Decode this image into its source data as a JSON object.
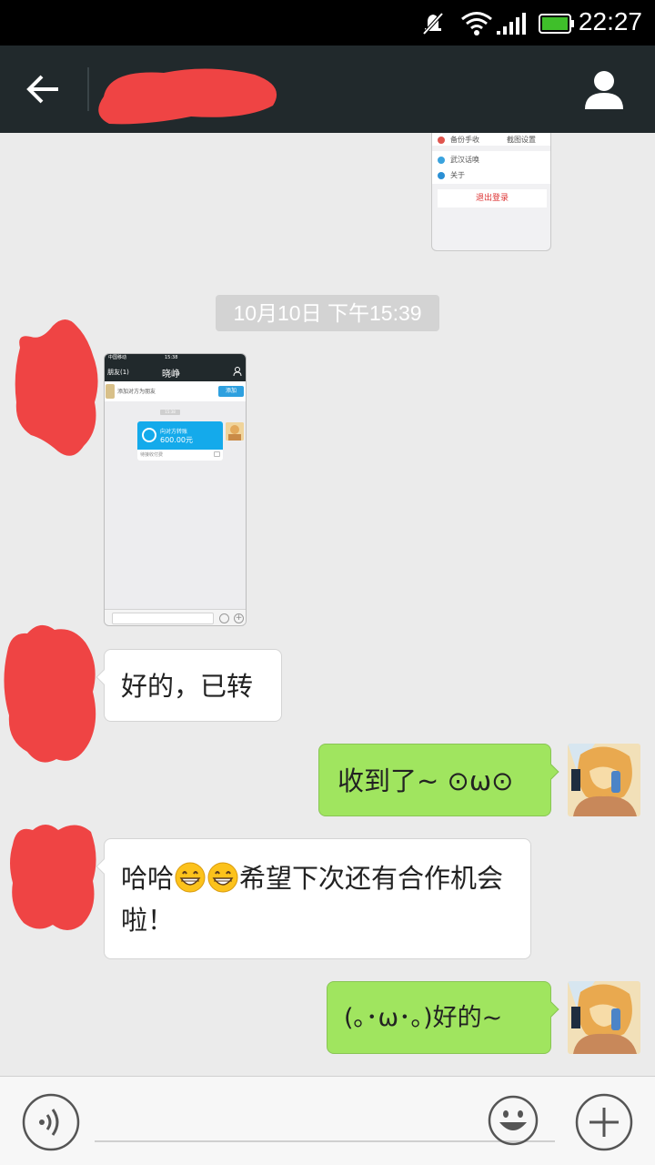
{
  "status_bar": {
    "time": "22:27",
    "icons": [
      "notifications-muted-icon",
      "wifi-icon",
      "signal-icon",
      "battery-icon"
    ],
    "battery_color": "#3fbf2a"
  },
  "title_bar": {
    "back_icon": "back-arrow-icon",
    "title": "",
    "profile_icon": "profile-icon",
    "background": "#21292c"
  },
  "top_screenshot": {
    "rows": [
      "备份手收",
      "截图设置",
      "武汉话唤",
      "关于"
    ],
    "logout": "退出登录"
  },
  "timestamp": "10月10日 下午15:39",
  "embedded_screenshot": {
    "status_left": "中国移动 ",
    "status_time": "15:38",
    "nav_back": "朋友(1)",
    "nav_name": "晓峥",
    "add_friend_text": "添加对方为朋友",
    "add_button": "添加",
    "mini_timestamp": "15:38",
    "transfer_title": "向对方转账",
    "transfer_amount": "600.00元",
    "transfer_footer": "待接收付费"
  },
  "messages": [
    {
      "side": "left",
      "text": "好的，已转"
    },
    {
      "side": "right",
      "text": "收到了~ ⊙ω⊙"
    },
    {
      "side": "left",
      "text_before": "哈哈",
      "text_after": "希望下次还有合作机会啦！",
      "emoji": "grinning-face-icon"
    },
    {
      "side": "right",
      "text": "(｡･ω･｡)好的~"
    }
  ],
  "input_bar": {
    "voice_icon": "voice-icon",
    "emoji_icon": "emoji-icon",
    "plus_icon": "plus-icon"
  },
  "colors": {
    "chat_bg": "#ebebeb",
    "my_bubble": "#a0e55f",
    "their_bubble": "#ffffff",
    "redaction": "#ef4444"
  }
}
